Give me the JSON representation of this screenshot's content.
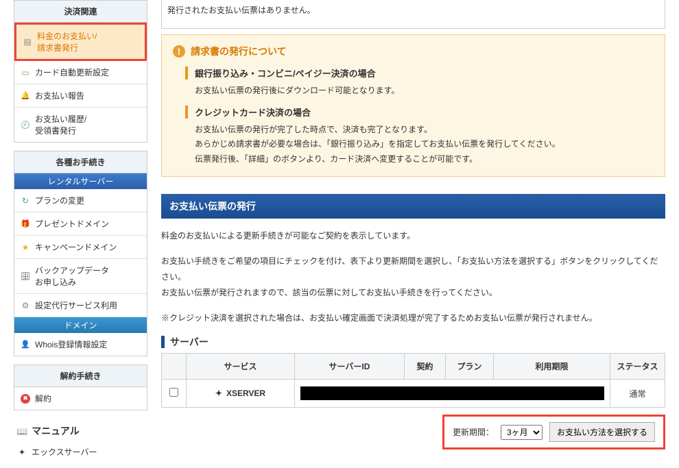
{
  "top_note": "発行されたお支払い伝票はありません。",
  "sidebar": {
    "payment": {
      "header": "決済関連",
      "items": [
        {
          "label": "料金のお支払い/\n請求書発行",
          "icon": "doc"
        },
        {
          "label": "カード自動更新設定",
          "icon": "card"
        },
        {
          "label": "お支払い報告",
          "icon": "bell"
        },
        {
          "label": "お支払い履歴/\n受領書発行",
          "icon": "clock"
        }
      ]
    },
    "procedures": {
      "header": "各種お手続き",
      "server_header": "レンタルサーバー",
      "server_items": [
        {
          "label": "プランの変更",
          "icon": "swap"
        },
        {
          "label": "プレゼントドメイン",
          "icon": "gift"
        },
        {
          "label": "キャンペーンドメイン",
          "icon": "star"
        },
        {
          "label": "バックアップデータ\nお申し込み",
          "icon": "db"
        },
        {
          "label": "設定代行サービス利用",
          "icon": "gear"
        }
      ],
      "domain_header": "ドメイン",
      "domain_items": [
        {
          "label": "Whois登録情報設定",
          "icon": "whois"
        }
      ]
    },
    "cancel": {
      "header": "解約手続き",
      "items": [
        {
          "label": "解約",
          "icon": "cancel"
        }
      ]
    },
    "manual": {
      "header": "マニュアル",
      "items": [
        {
          "label": "エックスサーバー",
          "icon": "xs"
        }
      ]
    }
  },
  "info": {
    "title": "請求書の発行について",
    "sections": [
      {
        "heading": "銀行振り込み・コンビニ/ペイジー決済の場合",
        "body": "お支払い伝票の発行後にダウンロード可能となります。"
      },
      {
        "heading": "クレジットカード決済の場合",
        "body": "お支払い伝票の発行が完了した時点で、決済も完了となります。\nあらかじめ請求書が必要な場合は、「銀行振り込み」を指定してお支払い伝票を発行してください。\n伝票発行後、「詳細」のボタンより、カード決済へ変更することが可能です。"
      }
    ]
  },
  "issue": {
    "title": "お支払い伝票の発行",
    "desc1": "料金のお支払いによる更新手続きが可能なご契約を表示しています。",
    "desc2": "お支払い手続きをご希望の項目にチェックを付け、表下より更新期間を選択し、「お支払い方法を選択する」ボタンをクリックしてください。\nお支払い伝票が発行されますので、該当の伝票に対してお支払い手続きを行ってください。",
    "desc3": "※クレジット決済を選択された場合は、お支払い確定画面で決済処理が完了するためお支払い伝票が発行されません。"
  },
  "server_section": "サーバー",
  "table": {
    "headers": [
      "",
      "サービス",
      "サーバーID",
      "契約",
      "プラン",
      "利用期限",
      "ステータス"
    ],
    "row": {
      "service": "XSERVER",
      "status": "通常"
    }
  },
  "action": {
    "period_label": "更新期間：",
    "period_value": "3ヶ月",
    "button": "お支払い方法を選択する"
  }
}
